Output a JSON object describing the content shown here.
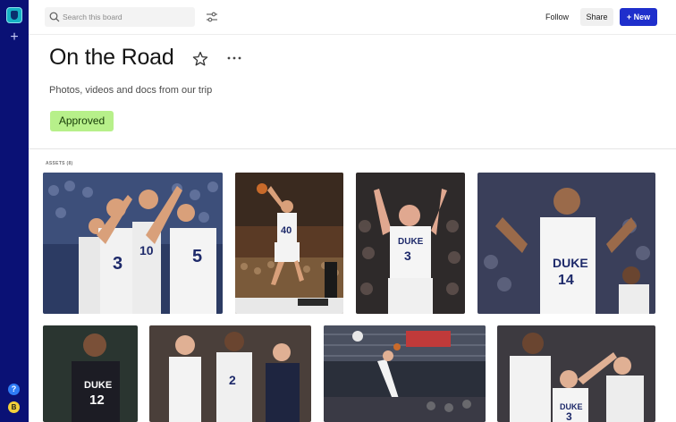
{
  "rail": {
    "logo_icon": "app-logo-icon",
    "plus_icon": "plus-icon",
    "help_label": "?",
    "user_initial": "B"
  },
  "toolbar": {
    "search_placeholder": "Search this board",
    "follow_label": "Follow",
    "share_label": "Share",
    "new_label": "+ New",
    "accent": "#1f2fcc"
  },
  "board": {
    "title": "On the Road",
    "description": "Photos, videos and docs from our trip",
    "status": "Approved",
    "status_color": "#b7f08a"
  },
  "assets": {
    "label": "ASSETS (8)",
    "items": [
      {
        "name": "basketball-team-huddle-photo",
        "jersey": "3",
        "jersey2": "5"
      },
      {
        "name": "basketball-dunk-photo",
        "jersey": "40"
      },
      {
        "name": "basketball-player-celebrating-photo",
        "jersey": "3",
        "team": "DUKE"
      },
      {
        "name": "basketball-player-shouting-photo",
        "jersey": "14",
        "team": "DUKE"
      },
      {
        "name": "basketball-player-portrait-photo",
        "jersey": "12",
        "team": "DUKE"
      },
      {
        "name": "basketball-players-and-coach-photo",
        "jersey": "2"
      },
      {
        "name": "basketball-arena-layup-photo",
        "jersey": ""
      },
      {
        "name": "basketball-players-pointing-photo",
        "jersey": "3",
        "team": "DUKE"
      }
    ]
  }
}
